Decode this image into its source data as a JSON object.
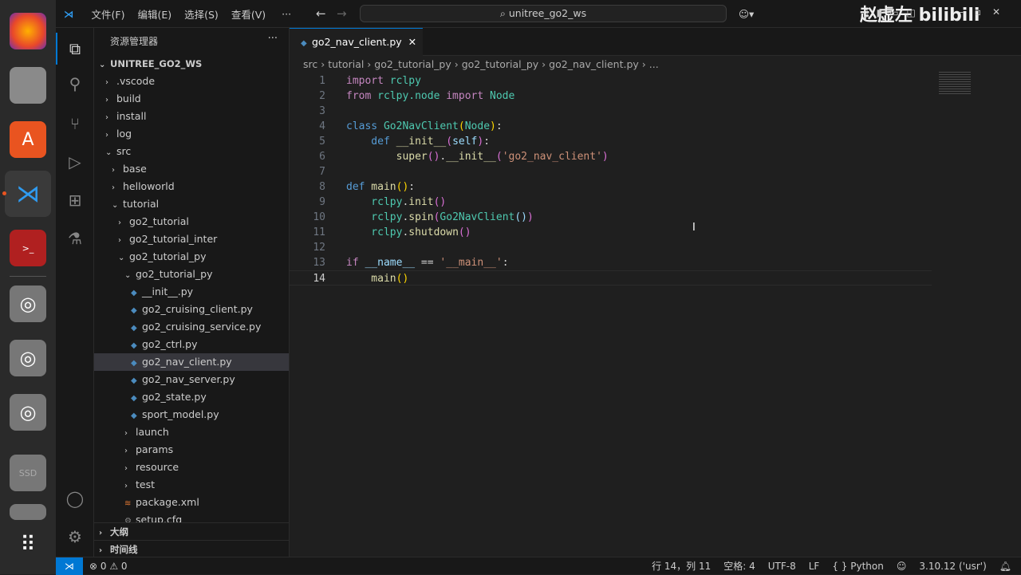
{
  "dock": {
    "items": [
      "firefox",
      "files",
      "app-center",
      "vscode",
      "terminal",
      "disk",
      "disk",
      "disk",
      "ssd",
      "disk",
      "apps"
    ],
    "ssd_label": "SSD"
  },
  "titlebar": {
    "menus": [
      "文件(F)",
      "编辑(E)",
      "选择(S)",
      "查看(V)",
      "···"
    ],
    "search": "unitree_go2_ws",
    "watermark": "赵虚左 bilibili"
  },
  "sidebar": {
    "title": "资源管理器",
    "more": "···",
    "root": "UNITREE_GO2_WS",
    "items": [
      {
        "label": ".vscode",
        "depth": 1,
        "type": "folder",
        "open": false
      },
      {
        "label": "build",
        "depth": 1,
        "type": "folder",
        "open": false
      },
      {
        "label": "install",
        "depth": 1,
        "type": "folder",
        "open": false
      },
      {
        "label": "log",
        "depth": 1,
        "type": "folder",
        "open": false
      },
      {
        "label": "src",
        "depth": 1,
        "type": "folder",
        "open": true
      },
      {
        "label": "base",
        "depth": 2,
        "type": "folder",
        "open": false
      },
      {
        "label": "helloworld",
        "depth": 2,
        "type": "folder",
        "open": false
      },
      {
        "label": "tutorial",
        "depth": 2,
        "type": "folder",
        "open": true
      },
      {
        "label": "go2_tutorial",
        "depth": 3,
        "type": "folder",
        "open": false
      },
      {
        "label": "go2_tutorial_inter",
        "depth": 3,
        "type": "folder",
        "open": false
      },
      {
        "label": "go2_tutorial_py",
        "depth": 3,
        "type": "folder",
        "open": true
      },
      {
        "label": "go2_tutorial_py",
        "depth": 4,
        "type": "folder",
        "open": true
      },
      {
        "label": "__init__.py",
        "depth": 5,
        "type": "py"
      },
      {
        "label": "go2_cruising_client.py",
        "depth": 5,
        "type": "py"
      },
      {
        "label": "go2_cruising_service.py",
        "depth": 5,
        "type": "py"
      },
      {
        "label": "go2_ctrl.py",
        "depth": 5,
        "type": "py"
      },
      {
        "label": "go2_nav_client.py",
        "depth": 5,
        "type": "py",
        "selected": true
      },
      {
        "label": "go2_nav_server.py",
        "depth": 5,
        "type": "py"
      },
      {
        "label": "go2_state.py",
        "depth": 5,
        "type": "py"
      },
      {
        "label": "sport_model.py",
        "depth": 5,
        "type": "py"
      },
      {
        "label": "launch",
        "depth": 4,
        "type": "folder",
        "open": false
      },
      {
        "label": "params",
        "depth": 4,
        "type": "folder",
        "open": false
      },
      {
        "label": "resource",
        "depth": 4,
        "type": "folder",
        "open": false
      },
      {
        "label": "test",
        "depth": 4,
        "type": "folder",
        "open": false
      },
      {
        "label": "package.xml",
        "depth": 4,
        "type": "xml"
      },
      {
        "label": "setup.cfg",
        "depth": 4,
        "type": "cfg"
      }
    ],
    "outline": "大纲",
    "timeline": "时间线"
  },
  "editor": {
    "tab": "go2_nav_client.py",
    "breadcrumbs": [
      "src",
      "tutorial",
      "go2_tutorial_py",
      "go2_tutorial_py",
      "go2_nav_client.py",
      "..."
    ],
    "current_line": 14,
    "lines": [
      [
        [
          "import",
          "kw"
        ],
        [
          " rclpy",
          "cl"
        ]
      ],
      [
        [
          "from",
          "kw"
        ],
        [
          " rclpy.node ",
          "cl"
        ],
        [
          "import",
          "kw"
        ],
        [
          " Node",
          "cl"
        ]
      ],
      [],
      [
        [
          "class",
          "kb"
        ],
        [
          " Go2NavClient",
          "cl"
        ],
        [
          "(",
          "pn"
        ],
        [
          "Node",
          "cl"
        ],
        [
          ")",
          "pn"
        ],
        [
          ":",
          "pl"
        ]
      ],
      [
        [
          "    def",
          "kb"
        ],
        [
          " __init__",
          "fn"
        ],
        [
          "(",
          "pu"
        ],
        [
          "self",
          "vr"
        ],
        [
          ")",
          "pu"
        ],
        [
          ":",
          "pl"
        ]
      ],
      [
        [
          "        super",
          "fn"
        ],
        [
          "()",
          "pu"
        ],
        [
          ".",
          "pl"
        ],
        [
          "__init__",
          "fn"
        ],
        [
          "(",
          "pu"
        ],
        [
          "'go2_nav_client'",
          "st"
        ],
        [
          ")",
          "pu"
        ]
      ],
      [],
      [
        [
          "def",
          "kb"
        ],
        [
          " main",
          "fn"
        ],
        [
          "()",
          "pn"
        ],
        [
          ":",
          "pl"
        ]
      ],
      [
        [
          "    rclpy",
          "cl"
        ],
        [
          ".",
          "pl"
        ],
        [
          "init",
          "fn"
        ],
        [
          "()",
          "pu"
        ]
      ],
      [
        [
          "    rclpy",
          "cl"
        ],
        [
          ".",
          "pl"
        ],
        [
          "spin",
          "fn"
        ],
        [
          "(",
          "pu"
        ],
        [
          "Go2NavClient",
          "cl"
        ],
        [
          "()",
          "vr"
        ],
        [
          ")",
          "pu"
        ]
      ],
      [
        [
          "    rclpy",
          "cl"
        ],
        [
          ".",
          "pl"
        ],
        [
          "shutdown",
          "fn"
        ],
        [
          "()",
          "pu"
        ]
      ],
      [],
      [
        [
          "if",
          "kw"
        ],
        [
          " __name__",
          "vr"
        ],
        [
          " == ",
          "pl"
        ],
        [
          "'__main__'",
          "st"
        ],
        [
          ":",
          "pl"
        ]
      ],
      [
        [
          "    main",
          "fn"
        ],
        [
          "()",
          "pn"
        ]
      ]
    ]
  },
  "status": {
    "errors": "0",
    "warnings": "0",
    "position": "行 14，列 11",
    "spaces": "空格: 4",
    "encoding": "UTF-8",
    "eol": "LF",
    "language_icon": "{ }",
    "language": "Python",
    "interpreter": "3.10.12 ('usr')"
  }
}
